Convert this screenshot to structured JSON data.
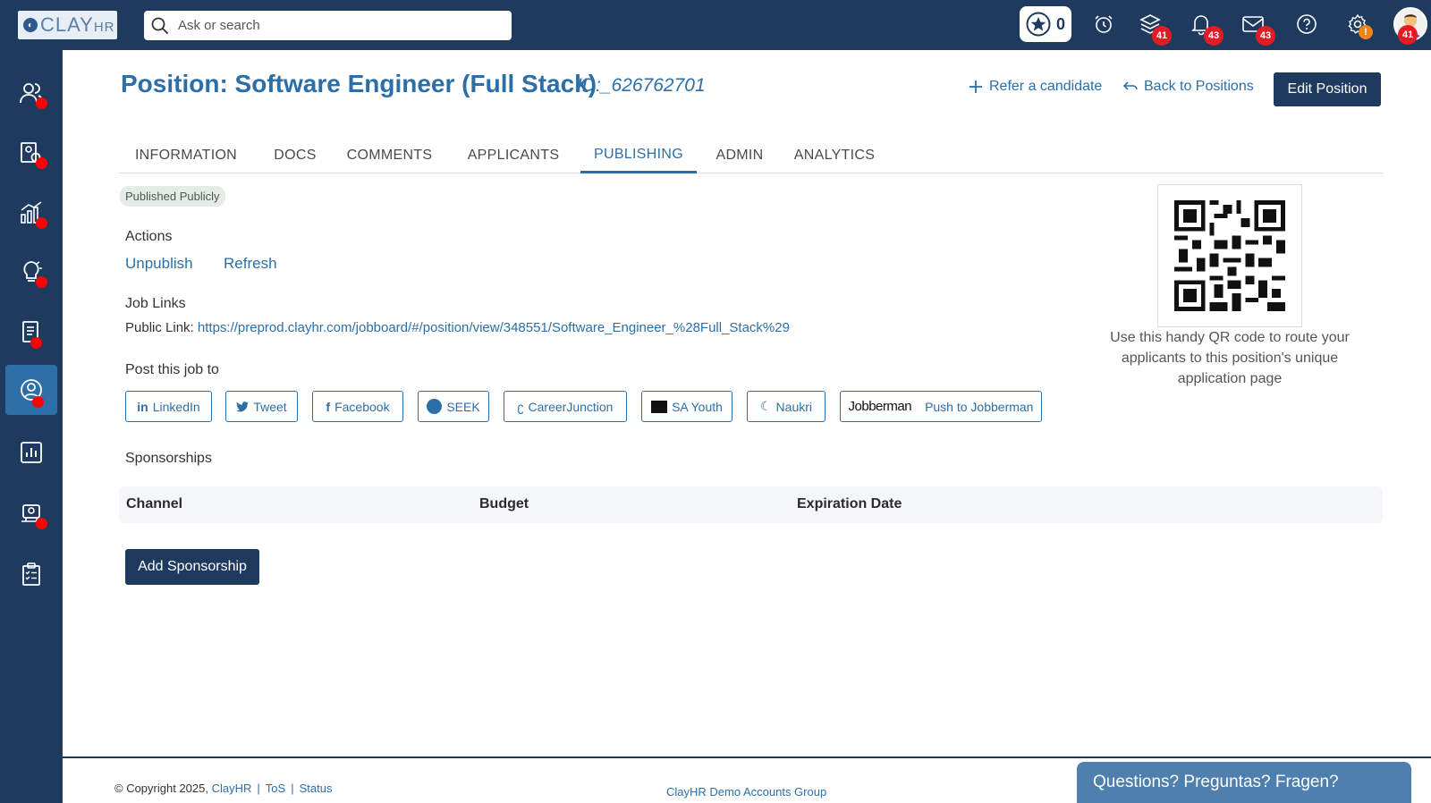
{
  "app": {
    "logo_text": "CLAY",
    "logo_suffix": "HR",
    "search_placeholder": "Ask or search",
    "star_count": "0",
    "badges": {
      "layers": "41",
      "notifications": "43",
      "messages": "43",
      "avatar": "41",
      "settings_warning": "!"
    }
  },
  "sidebar": {
    "items": [
      {
        "name": "people-icon",
        "active": false,
        "dot": true
      },
      {
        "name": "candidate-search-icon",
        "active": false,
        "dot": true
      },
      {
        "name": "analytics-growth-icon",
        "active": false,
        "dot": true
      },
      {
        "name": "ideas-icon",
        "active": false,
        "dot": true
      },
      {
        "name": "documents-icon",
        "active": false,
        "dot": true
      },
      {
        "name": "recruiting-icon",
        "active": true,
        "dot": true
      },
      {
        "name": "reports-icon",
        "active": false,
        "dot": false
      },
      {
        "name": "onboarding-icon",
        "active": false,
        "dot": true
      },
      {
        "name": "checklist-icon",
        "active": false,
        "dot": false
      }
    ]
  },
  "header": {
    "title": "Position: Software Engineer (Full Stack)",
    "position_id": "ID:_626762701",
    "refer_label": "Refer a candidate",
    "back_label": "Back to Positions",
    "edit_label": "Edit Position"
  },
  "tabs": [
    "INFORMATION",
    "DOCS",
    "COMMENTS",
    "APPLICANTS",
    "PUBLISHING",
    "ADMIN",
    "ANALYTICS"
  ],
  "active_tab": "PUBLISHING",
  "publishing": {
    "status": "Published Publicly",
    "actions_heading": "Actions",
    "unpublish_label": "Unpublish",
    "refresh_label": "Refresh",
    "job_links_heading": "Job Links",
    "public_link_label": "Public Link:",
    "public_link_url": "https://preprod.clayhr.com/jobboard/#/position/view/348551/Software_Engineer_%28Full_Stack%29",
    "post_heading": "Post this job to",
    "channels": {
      "linkedin": "LinkedIn",
      "tweet": "Tweet",
      "facebook": "Facebook",
      "seek": "SEEK",
      "careerjunction": "CareerJunction",
      "sayouth": "SA Youth",
      "naukri": "Naukri",
      "jobberman_logo": "Jobberman",
      "jobberman_push": "Push to Jobberman"
    },
    "qr_caption": "Use this handy QR code to route your applicants to this position's unique application page"
  },
  "sponsorships": {
    "heading": "Sponsorships",
    "columns": [
      "Channel",
      "Budget",
      "Expiration Date"
    ],
    "add_label": "Add Sponsorship"
  },
  "footer": {
    "copyright": "© Copyright 2025,",
    "company": "ClayHR",
    "tos": "ToS",
    "status": "Status",
    "group": "ClayHR Demo Accounts Group",
    "chat": "Questions? Preguntas? Fragen?"
  },
  "colors": {
    "navy": "#1e3a5f",
    "accent": "#2c6fa8",
    "badge_red": "#e51b24",
    "warning_orange": "#f0841c"
  }
}
